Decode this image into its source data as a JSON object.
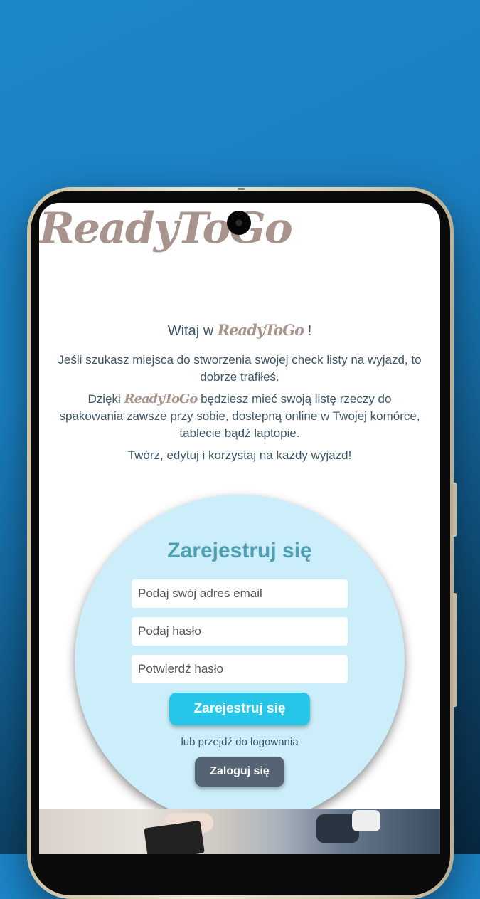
{
  "app": {
    "logo_text": "ReadyToGo"
  },
  "intro": {
    "welcome_prefix": "Witaj w",
    "welcome_brand": "ReadyToGo",
    "welcome_suffix": "!",
    "paragraph1": "Jeśli szukasz miejsca do stworzenia swojej check listy na wyjazd, to dobrze trafiłeś.",
    "paragraph2_prefix": "Dzięki",
    "paragraph2_brand": "ReadyToGo",
    "paragraph2_rest": "będziesz mieć swoją listę rzeczy do spakowania zawsze przy sobie, dostepną online w Twojej komórce, tablecie bądź laptopie.",
    "paragraph3": "Twórz, edytuj i korzystaj na każdy wyjazd!"
  },
  "register": {
    "title": "Zarejestruj się",
    "email_placeholder": "Podaj swój adres email",
    "password_placeholder": "Podaj hasło",
    "confirm_placeholder": "Potwierdź hasło",
    "submit_label": "Zarejestruj się",
    "or_text": "lub przejdź do logowania",
    "login_label": "Zaloguj się"
  },
  "colors": {
    "background": "#1a80c2",
    "logo": "#a8948d",
    "text": "#3d5566",
    "circle": "#cbeefa",
    "title": "#4f9fb3",
    "primary_button": "#26c6e8",
    "secondary_button": "#546474"
  }
}
